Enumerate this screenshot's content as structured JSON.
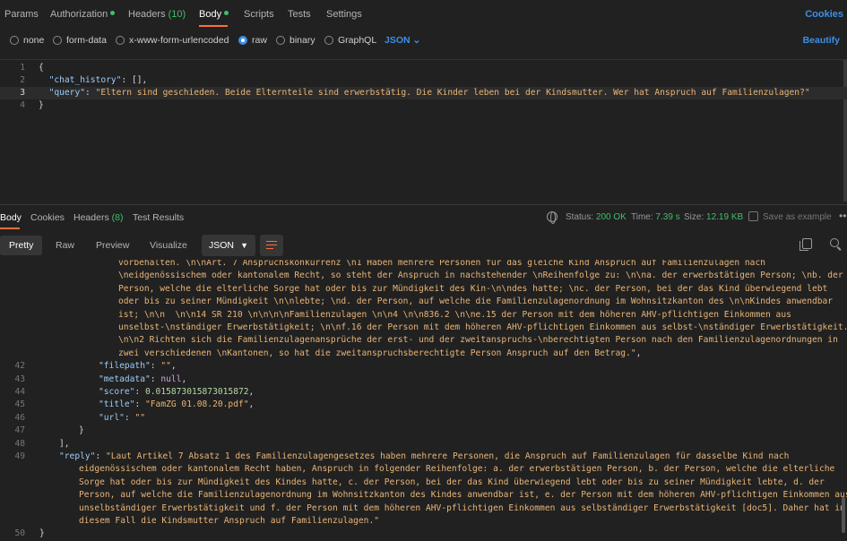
{
  "request_tabs": {
    "params": "Params",
    "authorization": "Authorization",
    "headers": "Headers",
    "headers_count": "(10)",
    "body": "Body",
    "scripts": "Scripts",
    "tests": "Tests",
    "settings": "Settings",
    "cookies": "Cookies"
  },
  "body_types": {
    "options": [
      "none",
      "form-data",
      "x-www-form-urlencoded",
      "raw",
      "binary",
      "GraphQL"
    ],
    "selected": "raw",
    "format": "JSON",
    "beautify": "Beautify"
  },
  "request_code": [
    {
      "n": "1",
      "parts": [
        [
          "p",
          "{"
        ]
      ]
    },
    {
      "n": "2",
      "parts": [
        [
          "p",
          "  "
        ],
        [
          "k",
          "\"chat_history\""
        ],
        [
          "p",
          ": [],"
        ]
      ]
    },
    {
      "n": "3",
      "parts": [
        [
          "p",
          "  "
        ],
        [
          "k",
          "\"query\""
        ],
        [
          "p",
          ": "
        ],
        [
          "s",
          "\"Eltern sind geschieden. Beide Elternteile sind erwerbstätig. Die Kinder leben bei der Kindsmutter. Wer hat Anspruch auf Familienzulagen?\""
        ]
      ]
    },
    {
      "n": "4",
      "parts": [
        [
          "p",
          "}"
        ]
      ]
    }
  ],
  "response_tabs": {
    "body": "Body",
    "cookies": "Cookies",
    "headers": "Headers",
    "headers_count": "(8)",
    "test_results": "Test Results"
  },
  "status": {
    "status_label": "Status:",
    "status_value": "200 OK",
    "time_label": "Time:",
    "time_value": "7.39 s",
    "size_label": "Size:",
    "size_value": "12.19 KB",
    "save_example": "Save as example"
  },
  "response_toolbar": {
    "views": [
      "Pretty",
      "Raw",
      "Preview",
      "Visualize"
    ],
    "active_view": "Pretty",
    "format": "JSON"
  },
  "response_code": [
    {
      "n": "",
      "indent": 132,
      "parts": [
        [
          "s",
          "vorbehalten. \\n\\nArt. 7 Anspruchskonkurrenz \\n1 Haben mehrere Personen für das gleiche Kind Anspruch auf Familienzulagen nach"
        ]
      ]
    },
    {
      "n": "",
      "indent": 132,
      "parts": [
        [
          "s",
          "\\neidgenössischem oder kantonalem Recht, so steht der Anspruch in nachstehender \\nReihenfolge zu: \\n\\na. der erwerbstätigen Person; \\nb. der"
        ]
      ]
    },
    {
      "n": "",
      "indent": 132,
      "parts": [
        [
          "s",
          "Person, welche die elterliche Sorge hat oder bis zur Mündigkeit des Kin-\\n\\ndes hatte; \\nc. der Person, bei der das Kind überwiegend lebt"
        ]
      ]
    },
    {
      "n": "",
      "indent": 132,
      "parts": [
        [
          "s",
          "oder bis zu seiner Mündigkeit \\n\\nlebte; \\nd. der Person, auf welche die Familienzulagenordnung im Wohnsitzkanton des \\n\\nKindes anwendbar"
        ]
      ]
    },
    {
      "n": "",
      "indent": 132,
      "parts": [
        [
          "s",
          "ist; \\n\\n  \\n\\n14 SR 210 \\n\\n\\n\\nFamilienzulagen \\n\\n4 \\n\\n836.2 \\n\\ne.15 der Person mit dem höheren AHV-pflichtigen Einkommen aus"
        ]
      ]
    },
    {
      "n": "",
      "indent": 132,
      "parts": [
        [
          "s",
          "unselbst-\\nständiger Erwerbstätigkeit; \\n\\nf.16 der Person mit dem höheren AHV-pflichtigen Einkommen aus selbst-\\nständiger Erwerbstätigkeit."
        ]
      ]
    },
    {
      "n": "",
      "indent": 132,
      "parts": [
        [
          "s",
          "\\n\\n2 Richten sich die Familienzulagenansprüche der erst- und der zweitanspruchs-\\nberechtigten Person nach den Familienzulagenordnungen in"
        ]
      ]
    },
    {
      "n": "",
      "indent": 132,
      "parts": [
        [
          "s",
          "zwei verschiedenen \\nKantonen, so hat die zweitanspruchsberechtigte Person Anspruch auf den Betrag.\""
        ],
        [
          "p",
          ","
        ]
      ]
    },
    {
      "n": "42",
      "indent": 110,
      "parts": [
        [
          "k",
          "\"filepath\""
        ],
        [
          "p",
          ": "
        ],
        [
          "s",
          "\"\""
        ],
        [
          "p",
          ","
        ]
      ]
    },
    {
      "n": "43",
      "indent": 110,
      "parts": [
        [
          "k",
          "\"metadata\""
        ],
        [
          "p",
          ": "
        ],
        [
          "kw",
          "null"
        ],
        [
          "p",
          ","
        ]
      ]
    },
    {
      "n": "44",
      "indent": 110,
      "parts": [
        [
          "k",
          "\"score\""
        ],
        [
          "p",
          ": "
        ],
        [
          "n",
          "0.015873015873015872"
        ],
        [
          "p",
          ","
        ]
      ]
    },
    {
      "n": "45",
      "indent": 110,
      "parts": [
        [
          "k",
          "\"title\""
        ],
        [
          "p",
          ": "
        ],
        [
          "s",
          "\"FamZG 01.08.20.pdf\""
        ],
        [
          "p",
          ","
        ]
      ]
    },
    {
      "n": "46",
      "indent": 110,
      "parts": [
        [
          "k",
          "\"url\""
        ],
        [
          "p",
          ": "
        ],
        [
          "s",
          "\"\""
        ]
      ]
    },
    {
      "n": "47",
      "indent": 88,
      "parts": [
        [
          "p",
          "}"
        ]
      ]
    },
    {
      "n": "48",
      "indent": 66,
      "parts": [
        [
          "p",
          "],"
        ]
      ]
    },
    {
      "n": "49",
      "indent": 66,
      "parts": [
        [
          "k",
          "\"reply\""
        ],
        [
          "p",
          ": "
        ],
        [
          "s",
          "\"Laut Artikel 7 Absatz 1 des Familienzulagengesetzes haben mehrere Personen, die Anspruch auf Familienzulagen für dasselbe Kind nach"
        ]
      ]
    },
    {
      "n": "",
      "indent": 88,
      "parts": [
        [
          "s",
          "eidgenössischem oder kantonalem Recht haben, Anspruch in folgender Reihenfolge: a. der erwerbstätigen Person, b. der Person, welche die elterliche"
        ]
      ]
    },
    {
      "n": "",
      "indent": 88,
      "parts": [
        [
          "s",
          "Sorge hat oder bis zur Mündigkeit des Kindes hatte, c. der Person, bei der das Kind überwiegend lebt oder bis zu seiner Mündigkeit lebte, d. der"
        ]
      ]
    },
    {
      "n": "",
      "indent": 88,
      "parts": [
        [
          "s",
          "Person, auf welche die Familienzulagenordnung im Wohnsitzkanton des Kindes anwendbar ist, e. der Person mit dem höheren AHV-pflichtigen Einkommen aus"
        ]
      ]
    },
    {
      "n": "",
      "indent": 88,
      "parts": [
        [
          "s",
          "unselbständiger Erwerbstätigkeit und f. der Person mit dem höheren AHV-pflichtigen Einkommen aus selbständiger Erwerbstätigkeit [doc5]. Daher hat in"
        ]
      ]
    },
    {
      "n": "",
      "indent": 88,
      "parts": [
        [
          "s",
          "diesem Fall die Kindsmutter Anspruch auf Familienzulagen.\""
        ]
      ]
    },
    {
      "n": "50",
      "indent": 44,
      "parts": [
        [
          "p",
          "}"
        ]
      ]
    }
  ]
}
